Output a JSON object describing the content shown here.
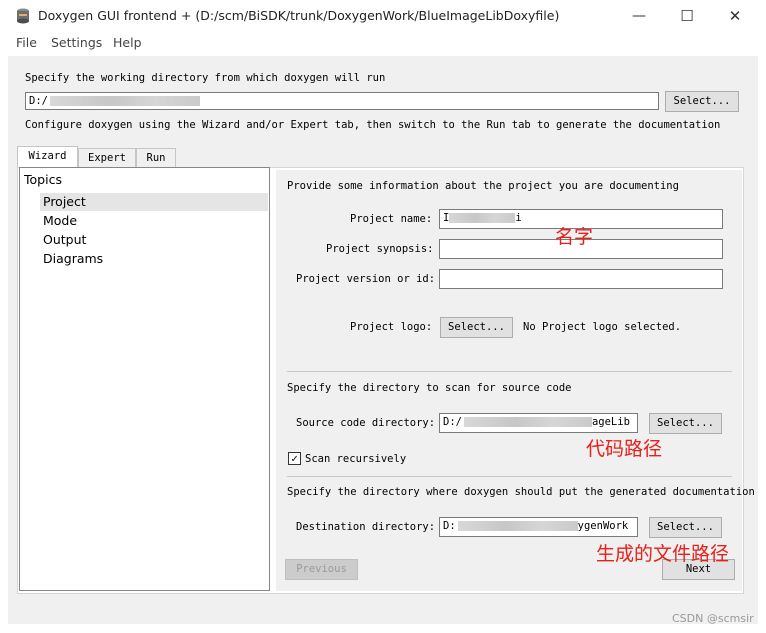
{
  "window": {
    "title": "Doxygen GUI frontend + (D:/scm/BiSDK/trunk/DoxygenWork/BlueImageLibDoxyfile)",
    "controls": {
      "minimize": "—",
      "maximize": "☐",
      "close": "✕"
    }
  },
  "menu": [
    "File",
    "Settings",
    "Help"
  ],
  "working_dir": {
    "label": "Specify the working directory from which doxygen will run",
    "value": "D:/",
    "select_label": "Select...",
    "hint": "Configure doxygen using the Wizard and/or Expert tab, then switch to the Run tab to generate the documentation"
  },
  "tabs": [
    "Wizard",
    "Expert",
    "Run"
  ],
  "topics": {
    "header": "Topics",
    "items": [
      "Project",
      "Mode",
      "Output",
      "Diagrams"
    ]
  },
  "project": {
    "intro": "Provide some information about the project you are documenting",
    "name_label": "Project name:",
    "name_value_start": "I",
    "name_value_end": "i",
    "synopsis_label": "Project synopsis:",
    "version_label": "Project version or id:",
    "logo_label": "Project logo:",
    "logo_button": "Select...",
    "logo_status": "No Project logo selected."
  },
  "source": {
    "intro": "Specify the directory to scan for source code",
    "label": "Source code directory:",
    "value_start": "D:/",
    "value_end": "ageLib",
    "select_label": "Select...",
    "recursive_label": "Scan recursively",
    "recursive_checked": "✓"
  },
  "destination": {
    "intro": "Specify the directory where doxygen should put the generated documentation",
    "label": "Destination directory:",
    "value_start": "D:",
    "value_end": "ygenWork",
    "select_label": "Select..."
  },
  "nav": {
    "previous": "Previous",
    "next": "Next"
  },
  "annotations": {
    "name": "名字",
    "source": "代码路径",
    "dest": "生成的文件路径"
  },
  "watermark": "CSDN @scmsir",
  "colors": {
    "annotation": "#e8201a",
    "window_bg": "#f0f0f0"
  }
}
